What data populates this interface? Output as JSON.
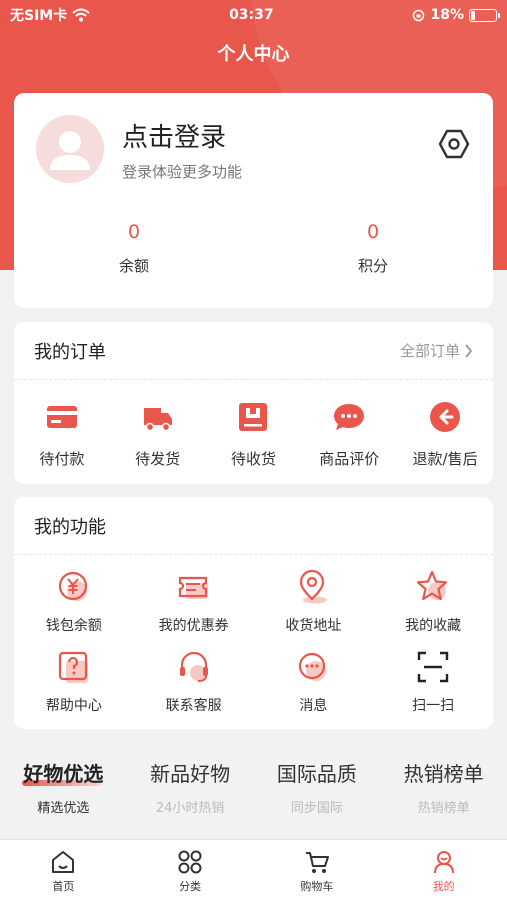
{
  "status_bar": {
    "carrier": "无SIM卡",
    "time": "03:37",
    "battery": "18%",
    "battery_level": 0.18
  },
  "nav": {
    "title": "个人中心"
  },
  "profile": {
    "login_title": "点击登录",
    "login_subtitle": "登录体验更多功能",
    "stats": [
      {
        "value": "0",
        "label": "余额"
      },
      {
        "value": "0",
        "label": "积分"
      }
    ]
  },
  "orders": {
    "title": "我的订单",
    "see_all": "全部订单",
    "items": [
      {
        "label": "待付款",
        "icon": "card-icon"
      },
      {
        "label": "待发货",
        "icon": "truck-icon"
      },
      {
        "label": "待收货",
        "icon": "package-icon"
      },
      {
        "label": "商品评价",
        "icon": "comment-icon"
      },
      {
        "label": "退款/售后",
        "icon": "return-icon"
      }
    ]
  },
  "functions": {
    "title": "我的功能",
    "items": [
      {
        "label": "钱包余额",
        "icon": "yen-coin-icon"
      },
      {
        "label": "我的优惠券",
        "icon": "coupon-icon"
      },
      {
        "label": "收货地址",
        "icon": "location-pin-icon"
      },
      {
        "label": "我的收藏",
        "icon": "star-icon"
      },
      {
        "label": "帮助中心",
        "icon": "help-icon"
      },
      {
        "label": "联系客服",
        "icon": "headset-icon"
      },
      {
        "label": "消息",
        "icon": "message-icon"
      },
      {
        "label": "扫一扫",
        "icon": "scan-icon"
      }
    ]
  },
  "product_tabs": [
    {
      "title": "好物优选",
      "subtitle": "精选优选",
      "active": true
    },
    {
      "title": "新品好物",
      "subtitle": "24小时热销",
      "active": false
    },
    {
      "title": "国际品质",
      "subtitle": "同步国际",
      "active": false
    },
    {
      "title": "热销榜单",
      "subtitle": "热销榜单",
      "active": false
    }
  ],
  "tabbar": [
    {
      "label": "首页",
      "icon": "home-icon",
      "active": false
    },
    {
      "label": "分类",
      "icon": "category-grid-icon",
      "active": false
    },
    {
      "label": "购物车",
      "icon": "cart-icon",
      "active": false
    },
    {
      "label": "我的",
      "icon": "profile-icon",
      "active": true
    }
  ],
  "colors": {
    "accent": "#e9574c",
    "background": "#f2f2f2"
  }
}
